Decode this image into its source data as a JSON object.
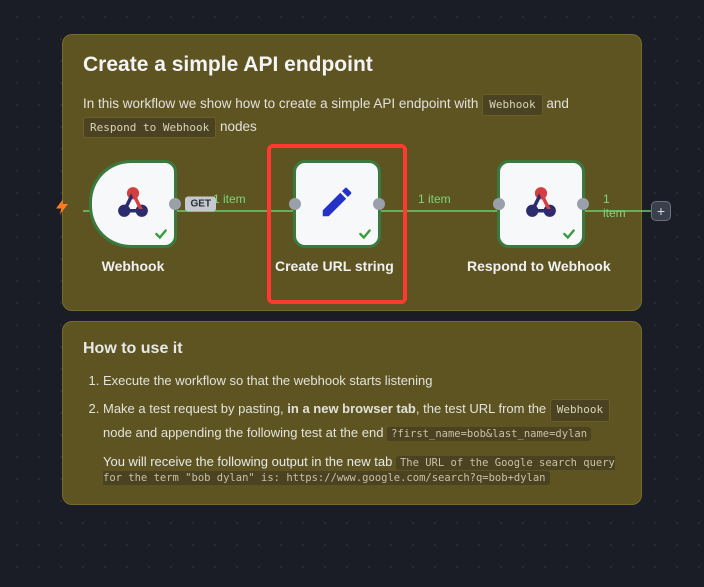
{
  "panel1": {
    "title": "Create a simple API endpoint",
    "desc_pre": "In this workflow we show how to create a simple API endpoint with ",
    "pill1": "Webhook",
    "desc_mid": " and ",
    "pill2": "Respond to Webhook",
    "desc_post": " nodes"
  },
  "flow": {
    "badge_1": "1 item",
    "badge_2": "1 item",
    "badge_3": "1 item",
    "method": "GET",
    "nodes": [
      {
        "label": "Webhook"
      },
      {
        "label": "Create URL string"
      },
      {
        "label": "Respond to Webhook"
      }
    ]
  },
  "panel2": {
    "title": "How to use it",
    "step1": "Execute the workflow so that the webhook starts listening",
    "step2_a": "Make a test request by pasting, ",
    "step2_b": "in a new browser tab",
    "step2_c": ", the test URL from the ",
    "step2_pill": "Webhook",
    "step2_d": " node and appending the following test at the end ",
    "step2_code": "?first_name=bob&last_name=dylan",
    "result_pre": "You will receive the following output in the new tab ",
    "result_code": "The URL of the Google search query for the term \"bob dylan\" is: https://www.google.com/search?q=bob+dylan"
  }
}
